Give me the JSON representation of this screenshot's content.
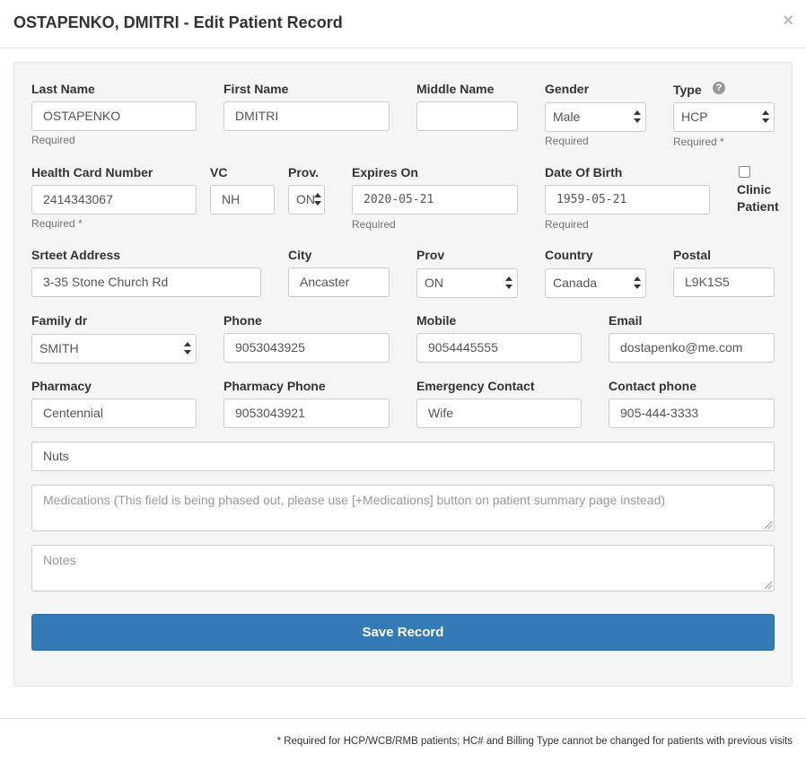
{
  "header": {
    "title": "OSTAPENKO, DMITRI - Edit Patient Record",
    "close": "×"
  },
  "help": {
    "required": "Required",
    "required_star": "Required *"
  },
  "fields": {
    "last_name": {
      "label": "Last Name",
      "value": "OSTAPENKO"
    },
    "first_name": {
      "label": "First Name",
      "value": "DMITRI"
    },
    "middle_name": {
      "label": "Middle Name",
      "value": ""
    },
    "gender": {
      "label": "Gender",
      "value": "Male"
    },
    "type": {
      "label": "Type",
      "value": "HCP"
    },
    "health_card": {
      "label": "Health Card Number",
      "value": "2414343067"
    },
    "vc": {
      "label": "VC",
      "value": "NH"
    },
    "prov_card": {
      "label": "Prov.",
      "value": "ON"
    },
    "expires_on": {
      "label": "Expires On",
      "value": "2020-05-21"
    },
    "dob": {
      "label": "Date Of Birth",
      "value": "1959-05-21"
    },
    "clinic_patient": {
      "label_line1": "Clinic",
      "label_line2": "Patient",
      "checked": false
    },
    "street": {
      "label": "Srteet Address",
      "value": "3-35 Stone Church Rd"
    },
    "city": {
      "label": "City",
      "value": "Ancaster"
    },
    "prov": {
      "label": "Prov",
      "value": "ON"
    },
    "country": {
      "label": "Country",
      "value": "Canada"
    },
    "postal": {
      "label": "Postal",
      "value": "L9K1S5"
    },
    "family_dr": {
      "label": "Family dr",
      "value": "SMITH"
    },
    "phone": {
      "label": "Phone",
      "value": "9053043925"
    },
    "mobile": {
      "label": "Mobile",
      "value": "9054445555"
    },
    "email": {
      "label": "Email",
      "value": "dostapenko@me.com"
    },
    "pharmacy": {
      "label": "Pharmacy",
      "value": "Centennial"
    },
    "pharmacy_phone": {
      "label": "Pharmacy Phone",
      "value": "9053043921"
    },
    "emergency_contact": {
      "label": "Emergency Contact",
      "value": "Wife"
    },
    "contact_phone": {
      "label": "Contact phone",
      "value": "905-444-3333"
    },
    "allergies": {
      "value": "Nuts"
    },
    "medications": {
      "placeholder": "Medications (This field is being phased out, please use [+Medications] button on patient summary page instead)"
    },
    "notes": {
      "placeholder": "Notes"
    }
  },
  "actions": {
    "save_label": "Save Record"
  },
  "footer": {
    "note": "* Required for HCP/WCB/RMB patients; HC# and Billing Type cannot be changed for patients with previous visits"
  }
}
